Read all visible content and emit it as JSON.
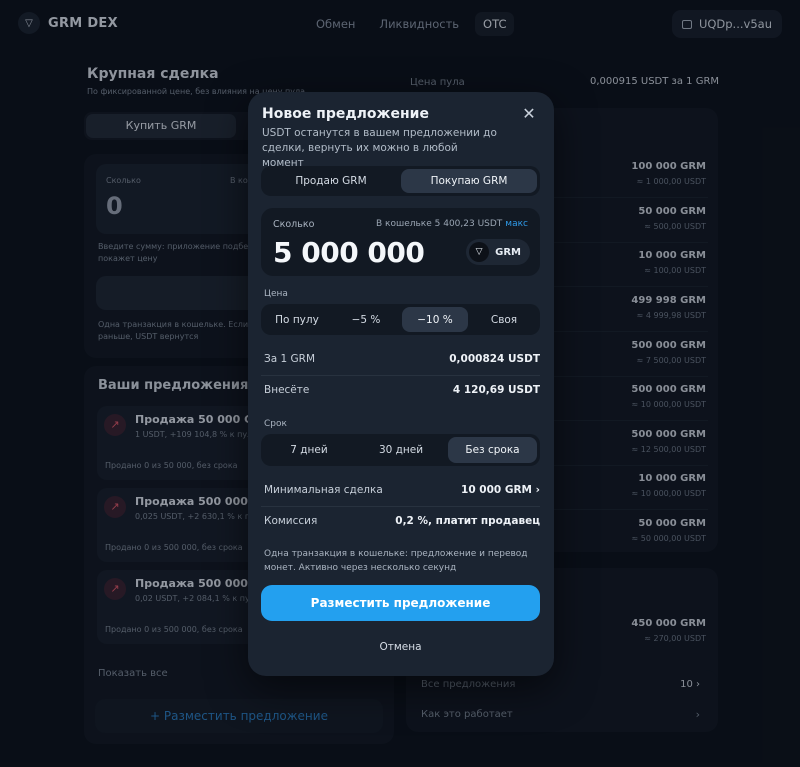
{
  "header": {
    "logo_glyph": "▽",
    "app_name": "GRM DEX",
    "nav": [
      "Обмен",
      "Ликвидность",
      "OTC"
    ],
    "wallet": "UQDp...v5au"
  },
  "background": {
    "title": "Крупная сделка",
    "subtitle": "По фиксированной цене, без влияния на цену пула",
    "buy_tab": "Купить GRM",
    "amount_label": "Сколько",
    "amount_wallet": "В кошельке",
    "amount_value": "0",
    "hint": "Введите сумму: приложение подбе",
    "hint2": "покажет цену",
    "enter_btn": "Введите с",
    "tx_note": "Одна транзакция в кошельке. Если",
    "tx_note2": "раньше, USDT вернутся",
    "offers_title": "Ваши предложения",
    "offers": [
      {
        "title": "Продажа 50 000 GRM",
        "sub": "1 USDT, +109 104,8 % к пулу",
        "foot": "Продано 0 из 50 000, без срока"
      },
      {
        "title": "Продажа 500 000 GRM",
        "sub": "0,025 USDT, +2 630,1 % к пулу",
        "foot": "Продано 0 из 500 000, без срока"
      },
      {
        "title": "Продажа 500 000 GRM",
        "sub": "0,02 USDT, +2 084,1 % к пулу",
        "foot": "Продано 0 из 500 000, без срока"
      }
    ],
    "show_all": "Показать все",
    "add_offer": "+ Разместить предложение",
    "pool_price_label": "Цена пула",
    "pool_price_value": "0,000915 USDT за 1 GRM",
    "right_rows": [
      {
        "amount": "100 000 GRM",
        "sub": "≈ 1 000,00 USDT"
      },
      {
        "amount": "50 000 GRM",
        "sub": "≈ 500,00 USDT"
      },
      {
        "amount": "10 000 GRM",
        "sub": "≈ 100,00 USDT"
      },
      {
        "amount": "499 998 GRM",
        "sub": "≈ 4 999,98 USDT"
      },
      {
        "amount": "500 000 GRM",
        "sub": "≈ 7 500,00 USDT"
      },
      {
        "amount": "500 000 GRM",
        "sub": "≈ 10 000,00 USDT"
      },
      {
        "amount": "500 000 GRM",
        "sub": "≈ 12 500,00 USDT"
      },
      {
        "amount": "10 000 GRM",
        "sub": "≈ 10 000,00 USDT"
      },
      {
        "amount": "50 000 GRM",
        "sub": "≈ 50 000,00 USDT"
      }
    ],
    "right_row_extra": {
      "amount": "450 000 GRM",
      "sub": "≈ 270,00 USDT"
    },
    "all_offers": "Все предложения",
    "all_offers_count": "10 ›",
    "how_it_works": "Как это работает",
    "how_chevron": "›"
  },
  "modal": {
    "title": "Новое предложение",
    "close": "✕",
    "description": "USDT останутся в вашем предложении до сделки, вернуть их можно в любой момент",
    "mode_tabs": [
      "Продаю GRM",
      "Покупаю GRM"
    ],
    "amount": {
      "label": "Сколько",
      "wallet": "В кошельке 5 400,23 USDT",
      "max": "макс",
      "value": "5 000 000",
      "token": "GRM",
      "token_glyph": "▽"
    },
    "price_label": "Цена",
    "price_tabs": [
      "По пулу",
      "−5 %",
      "−10 %",
      "Своя"
    ],
    "per_grm_label": "За 1 GRM",
    "per_grm_value": "0,000824 USDT",
    "deposit_label": "Внесёте",
    "deposit_value": "4 120,69 USDT",
    "term_label": "Срок",
    "term_tabs": [
      "7 дней",
      "30 дней",
      "Без срока"
    ],
    "min_deal_label": "Минимальная сделка",
    "min_deal_value": "10 000 GRM ›",
    "fee_label": "Комиссия",
    "fee_value": "0,2 %, платит продавец",
    "note": "Одна транзакция в кошельке: предложение и перевод монет. Активно через несколько секунд",
    "submit": "Разместить предложение",
    "cancel": "Отмена"
  },
  "colors": {
    "accent": "#23a0ef",
    "background": "#0c121b",
    "modal": "#1b2431"
  }
}
